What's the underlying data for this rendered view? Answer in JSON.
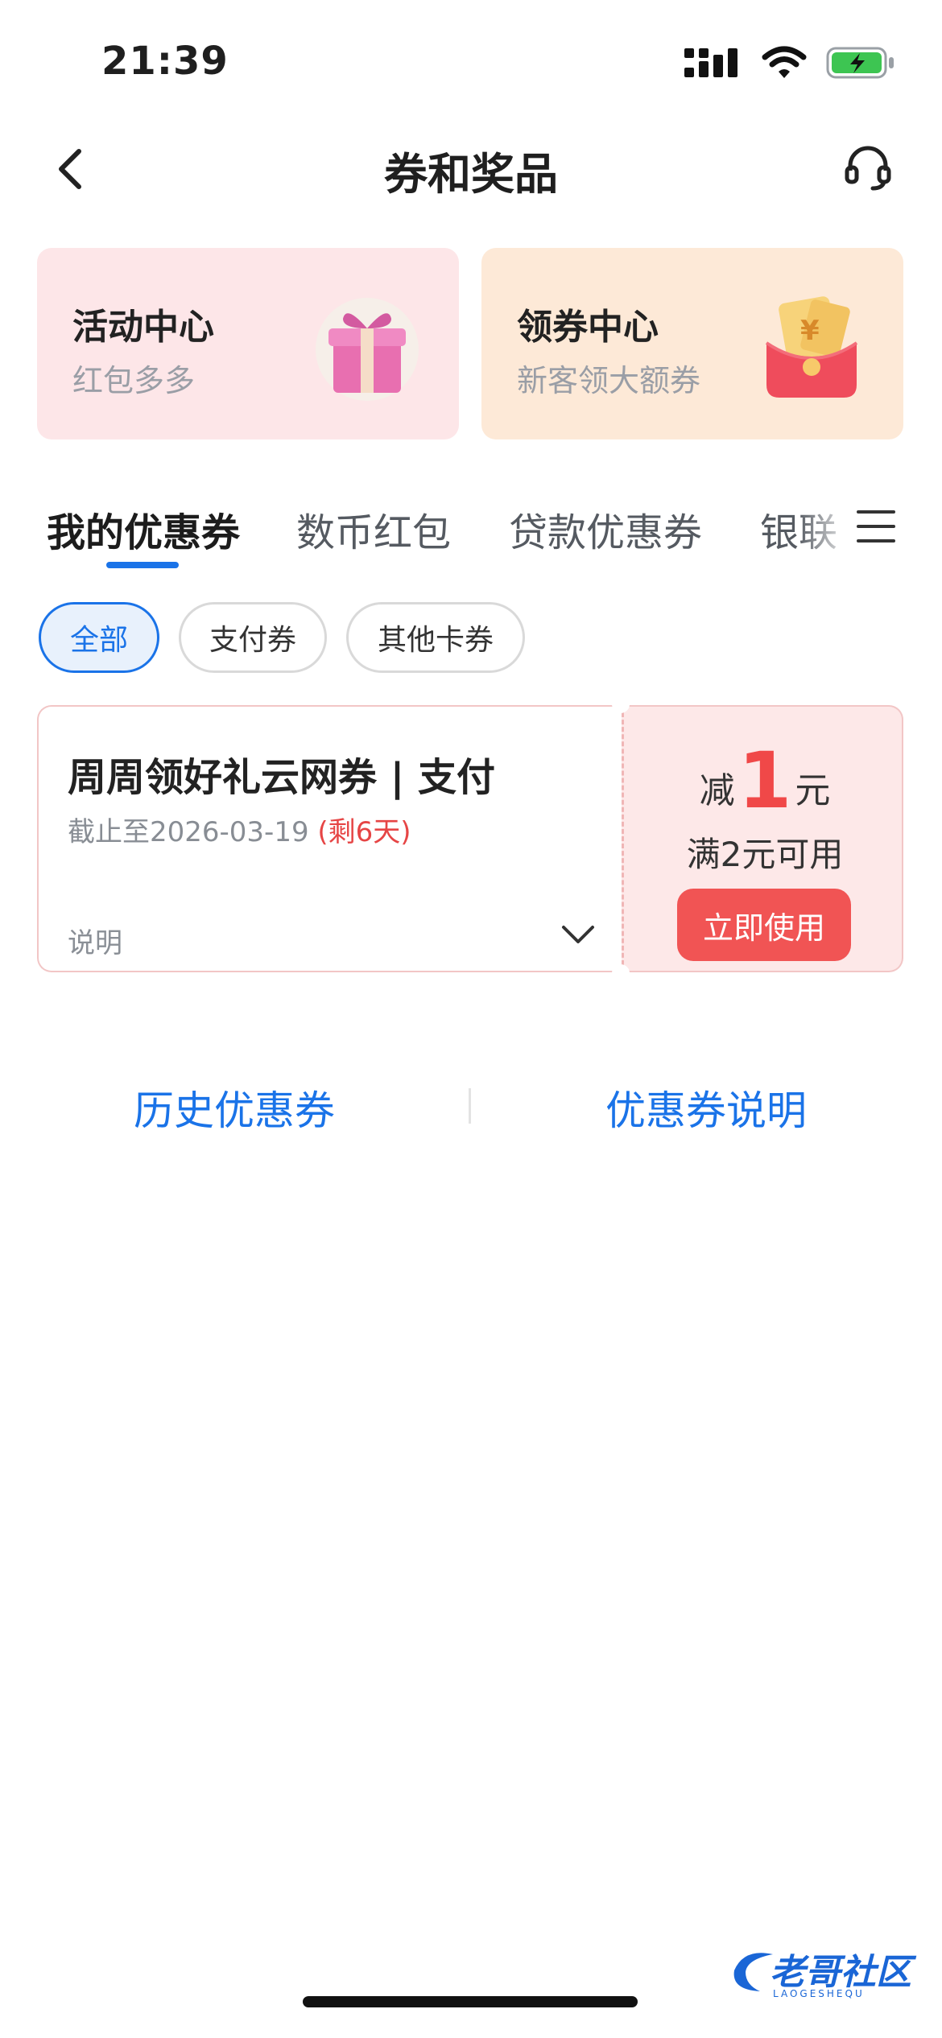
{
  "status_bar": {
    "time": "21:39"
  },
  "nav": {
    "title": "券和奖品",
    "back_icon": "chevron-left-icon",
    "service_icon": "headset-icon"
  },
  "promo_cards": [
    {
      "title": "活动中心",
      "subtitle": "红包多多",
      "icon": "gift-box-icon",
      "bg": "#fde6e8"
    },
    {
      "title": "领券中心",
      "subtitle": "新客领大额券",
      "icon": "red-envelope-icon",
      "bg": "#fde9d7"
    }
  ],
  "tabs": [
    {
      "label": "我的优惠券",
      "active": true
    },
    {
      "label": "数币红包",
      "active": false
    },
    {
      "label": "贷款优惠券",
      "active": false
    },
    {
      "label": "银联",
      "active": false
    }
  ],
  "filters": [
    {
      "label": "全部",
      "active": true
    },
    {
      "label": "支付券",
      "active": false
    },
    {
      "label": "其他卡券",
      "active": false
    }
  ],
  "coupon": {
    "title": "周周领好礼云网券 | 支付",
    "expiry": "截止至2026-03-19",
    "remaining": "(剩6天)",
    "description_label": "说明",
    "amount_prefix": "减",
    "amount": "1",
    "amount_unit": "元",
    "condition": "满2元可用",
    "use_button": "立即使用"
  },
  "links": {
    "history": "历史优惠券",
    "explanation": "优惠券说明"
  },
  "watermark": {
    "text": "老哥社区",
    "sub": "LAOGESHEQU"
  },
  "colors": {
    "accent": "#1a73e8",
    "coupon_red": "#f15454"
  }
}
